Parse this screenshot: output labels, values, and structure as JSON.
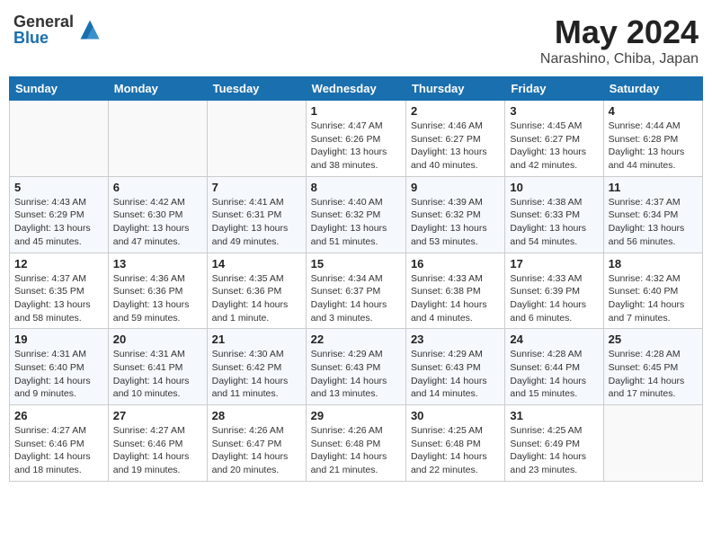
{
  "header": {
    "logo_general": "General",
    "logo_blue": "Blue",
    "month_title": "May 2024",
    "location": "Narashino, Chiba, Japan"
  },
  "days_of_week": [
    "Sunday",
    "Monday",
    "Tuesday",
    "Wednesday",
    "Thursday",
    "Friday",
    "Saturday"
  ],
  "weeks": [
    [
      {
        "day": "",
        "info": ""
      },
      {
        "day": "",
        "info": ""
      },
      {
        "day": "",
        "info": ""
      },
      {
        "day": "1",
        "info": "Sunrise: 4:47 AM\nSunset: 6:26 PM\nDaylight: 13 hours\nand 38 minutes."
      },
      {
        "day": "2",
        "info": "Sunrise: 4:46 AM\nSunset: 6:27 PM\nDaylight: 13 hours\nand 40 minutes."
      },
      {
        "day": "3",
        "info": "Sunrise: 4:45 AM\nSunset: 6:27 PM\nDaylight: 13 hours\nand 42 minutes."
      },
      {
        "day": "4",
        "info": "Sunrise: 4:44 AM\nSunset: 6:28 PM\nDaylight: 13 hours\nand 44 minutes."
      }
    ],
    [
      {
        "day": "5",
        "info": "Sunrise: 4:43 AM\nSunset: 6:29 PM\nDaylight: 13 hours\nand 45 minutes."
      },
      {
        "day": "6",
        "info": "Sunrise: 4:42 AM\nSunset: 6:30 PM\nDaylight: 13 hours\nand 47 minutes."
      },
      {
        "day": "7",
        "info": "Sunrise: 4:41 AM\nSunset: 6:31 PM\nDaylight: 13 hours\nand 49 minutes."
      },
      {
        "day": "8",
        "info": "Sunrise: 4:40 AM\nSunset: 6:32 PM\nDaylight: 13 hours\nand 51 minutes."
      },
      {
        "day": "9",
        "info": "Sunrise: 4:39 AM\nSunset: 6:32 PM\nDaylight: 13 hours\nand 53 minutes."
      },
      {
        "day": "10",
        "info": "Sunrise: 4:38 AM\nSunset: 6:33 PM\nDaylight: 13 hours\nand 54 minutes."
      },
      {
        "day": "11",
        "info": "Sunrise: 4:37 AM\nSunset: 6:34 PM\nDaylight: 13 hours\nand 56 minutes."
      }
    ],
    [
      {
        "day": "12",
        "info": "Sunrise: 4:37 AM\nSunset: 6:35 PM\nDaylight: 13 hours\nand 58 minutes."
      },
      {
        "day": "13",
        "info": "Sunrise: 4:36 AM\nSunset: 6:36 PM\nDaylight: 13 hours\nand 59 minutes."
      },
      {
        "day": "14",
        "info": "Sunrise: 4:35 AM\nSunset: 6:36 PM\nDaylight: 14 hours\nand 1 minute."
      },
      {
        "day": "15",
        "info": "Sunrise: 4:34 AM\nSunset: 6:37 PM\nDaylight: 14 hours\nand 3 minutes."
      },
      {
        "day": "16",
        "info": "Sunrise: 4:33 AM\nSunset: 6:38 PM\nDaylight: 14 hours\nand 4 minutes."
      },
      {
        "day": "17",
        "info": "Sunrise: 4:33 AM\nSunset: 6:39 PM\nDaylight: 14 hours\nand 6 minutes."
      },
      {
        "day": "18",
        "info": "Sunrise: 4:32 AM\nSunset: 6:40 PM\nDaylight: 14 hours\nand 7 minutes."
      }
    ],
    [
      {
        "day": "19",
        "info": "Sunrise: 4:31 AM\nSunset: 6:40 PM\nDaylight: 14 hours\nand 9 minutes."
      },
      {
        "day": "20",
        "info": "Sunrise: 4:31 AM\nSunset: 6:41 PM\nDaylight: 14 hours\nand 10 minutes."
      },
      {
        "day": "21",
        "info": "Sunrise: 4:30 AM\nSunset: 6:42 PM\nDaylight: 14 hours\nand 11 minutes."
      },
      {
        "day": "22",
        "info": "Sunrise: 4:29 AM\nSunset: 6:43 PM\nDaylight: 14 hours\nand 13 minutes."
      },
      {
        "day": "23",
        "info": "Sunrise: 4:29 AM\nSunset: 6:43 PM\nDaylight: 14 hours\nand 14 minutes."
      },
      {
        "day": "24",
        "info": "Sunrise: 4:28 AM\nSunset: 6:44 PM\nDaylight: 14 hours\nand 15 minutes."
      },
      {
        "day": "25",
        "info": "Sunrise: 4:28 AM\nSunset: 6:45 PM\nDaylight: 14 hours\nand 17 minutes."
      }
    ],
    [
      {
        "day": "26",
        "info": "Sunrise: 4:27 AM\nSunset: 6:46 PM\nDaylight: 14 hours\nand 18 minutes."
      },
      {
        "day": "27",
        "info": "Sunrise: 4:27 AM\nSunset: 6:46 PM\nDaylight: 14 hours\nand 19 minutes."
      },
      {
        "day": "28",
        "info": "Sunrise: 4:26 AM\nSunset: 6:47 PM\nDaylight: 14 hours\nand 20 minutes."
      },
      {
        "day": "29",
        "info": "Sunrise: 4:26 AM\nSunset: 6:48 PM\nDaylight: 14 hours\nand 21 minutes."
      },
      {
        "day": "30",
        "info": "Sunrise: 4:25 AM\nSunset: 6:48 PM\nDaylight: 14 hours\nand 22 minutes."
      },
      {
        "day": "31",
        "info": "Sunrise: 4:25 AM\nSunset: 6:49 PM\nDaylight: 14 hours\nand 23 minutes."
      },
      {
        "day": "",
        "info": ""
      }
    ]
  ]
}
